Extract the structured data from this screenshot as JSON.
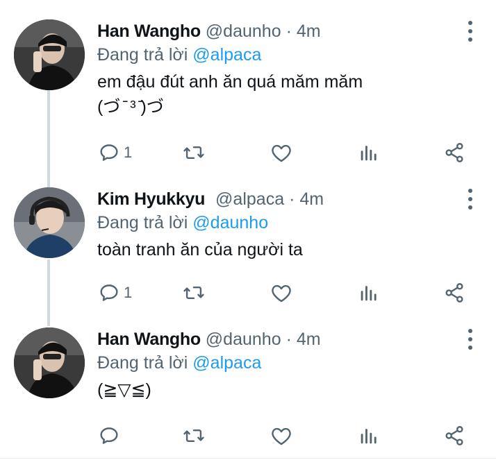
{
  "tweets": [
    {
      "name": "Han Wangho",
      "handle": "@daunho",
      "dot": "·",
      "time": "4m",
      "reply_prefix": "Đang trả lời",
      "reply_to": "@alpaca",
      "text": "em đậu đút anh ăn quá măm măm\n(づ ̄ ³ ̄)づ",
      "reply_count": "1"
    },
    {
      "name": "Kim Hyukkyu",
      "handle": "@alpaca",
      "dot": "·",
      "time": "4m",
      "reply_prefix": "Đang trả lời",
      "reply_to": "@daunho",
      "text": "toàn tranh ăn của người ta",
      "reply_count": "1"
    },
    {
      "name": "Han Wangho",
      "handle": "@daunho",
      "dot": "·",
      "time": "4m",
      "reply_prefix": "Đang trả lời",
      "reply_to": "@alpaca",
      "text": "(≧▽≦)",
      "reply_count": ""
    }
  ],
  "icons": {
    "reply": "reply-icon",
    "retweet": "retweet-icon",
    "like": "heart-icon",
    "analytics": "analytics-icon",
    "share": "share-icon",
    "more": "more-vertical-icon"
  },
  "colors": {
    "mention": "#1d9bf0",
    "secondary_text": "#536471",
    "icon": "#536471",
    "thread_line": "#cfd9de"
  }
}
